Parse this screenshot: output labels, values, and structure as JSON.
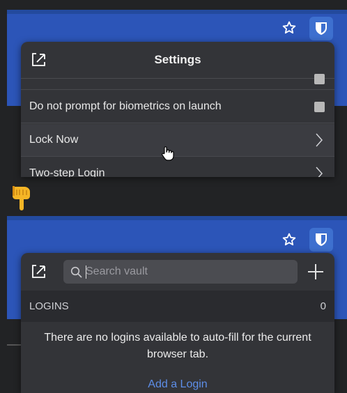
{
  "top": {
    "popup_title": "Settings",
    "rows": [
      {
        "label": "Do not prompt for biometrics on launch",
        "type": "checkbox"
      },
      {
        "label": "Lock Now",
        "type": "link"
      },
      {
        "label": "Two-step Login",
        "type": "link"
      }
    ]
  },
  "bottom": {
    "search_placeholder": "Search vault",
    "section_label": "LOGINS",
    "section_count": "0",
    "empty_message": "There are no logins available to auto-fill for the current browser tab.",
    "add_login": "Add a Login"
  },
  "icons": {
    "star": "star-icon",
    "shield": "bitwarden-shield-icon",
    "popout": "popout-icon",
    "chevron": "chevron-right-icon",
    "search": "search-icon",
    "plus": "plus-icon",
    "cursor": "hand-pointer-cursor",
    "pointing": "pointing-down-hand-emoji"
  },
  "colors": {
    "toolbar_blue": "#2c55b8",
    "popup_bg": "#333438",
    "link_blue": "#5d8ee8"
  }
}
